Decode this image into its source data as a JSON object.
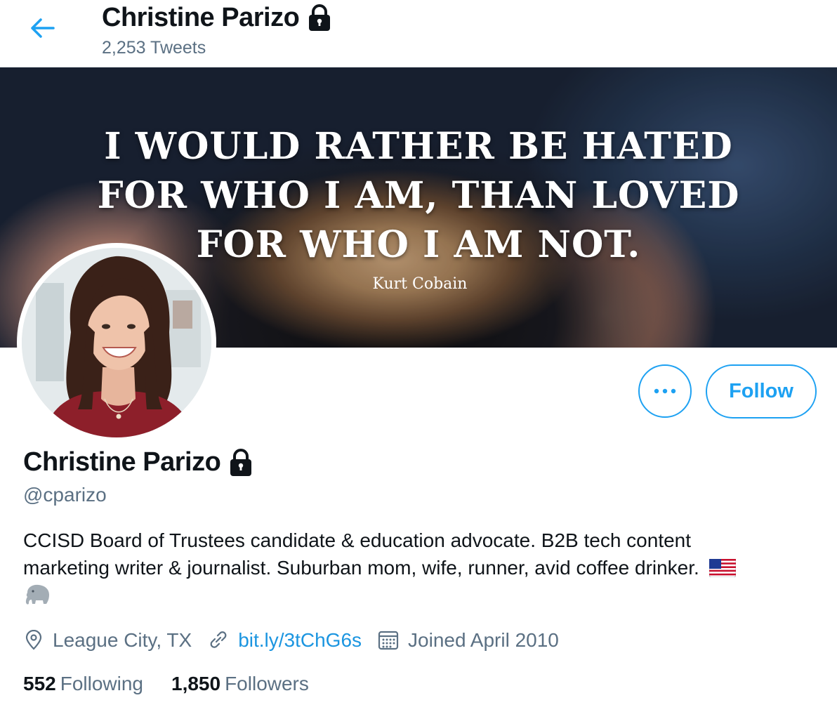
{
  "header": {
    "name": "Christine Parizo",
    "tweet_count": "2,253 Tweets"
  },
  "banner": {
    "quote_lines": [
      "I WOULD RATHER BE HATED",
      "FOR WHO I AM, THAN LOVED",
      "FOR WHO I AM NOT."
    ],
    "quote_author": "Kurt Cobain"
  },
  "actions": {
    "follow_label": "Follow"
  },
  "profile": {
    "name": "Christine Parizo",
    "handle": "@cparizo",
    "bio_line1": "CCISD Board of Trustees candidate & education advocate. B2B tech content",
    "bio_line2": "marketing writer & journalist. Suburban mom, wife, runner, avid coffee drinker.",
    "location": "League City, TX",
    "website": "bit.ly/3tChG6s",
    "joined": "Joined April 2010"
  },
  "stats": {
    "following_count": "552",
    "following_label": "Following",
    "followers_count": "1,850",
    "followers_label": "Followers"
  },
  "colors": {
    "accent": "#1da1f2",
    "secondary_text": "#5b7083",
    "primary_text": "#0f1419"
  },
  "icons": [
    "back-arrow-icon",
    "lock-icon",
    "more-icon",
    "location-icon",
    "link-icon",
    "calendar-icon",
    "us-flag-emoji",
    "elephant-emoji"
  ]
}
